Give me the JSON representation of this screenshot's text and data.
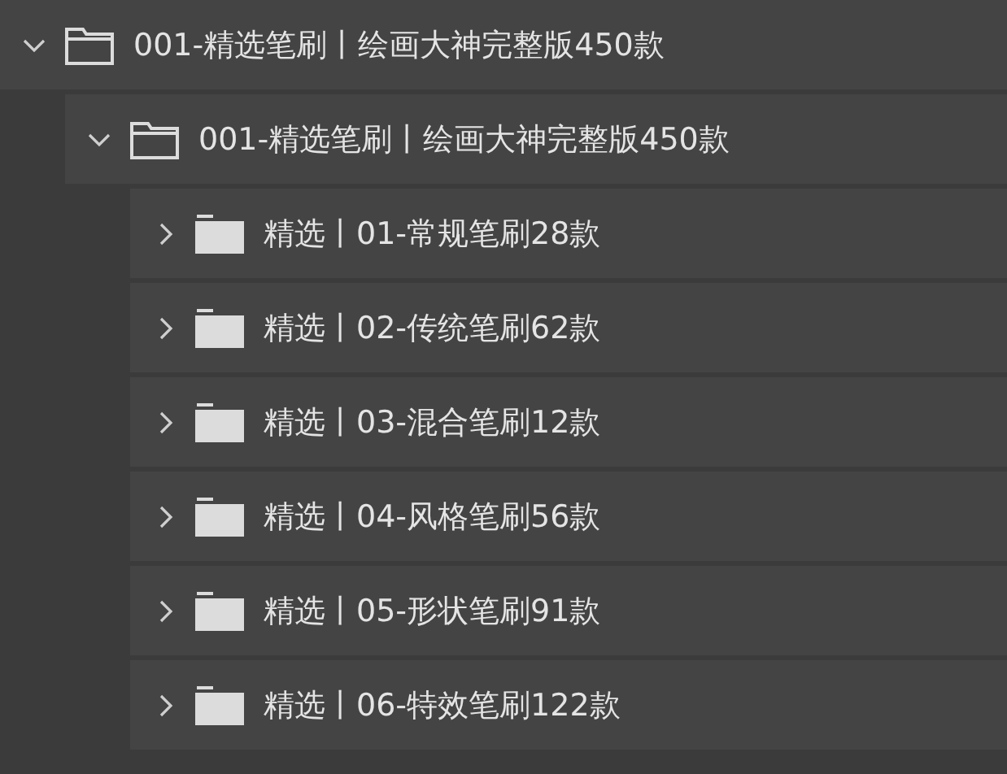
{
  "tree": [
    {
      "label": "001-精选笔刷丨绘画大神完整版450款",
      "expanded": true,
      "children": [
        {
          "label": "001-精选笔刷丨绘画大神完整版450款",
          "expanded": true,
          "children": [
            {
              "label": "精选丨01-常规笔刷28款",
              "expanded": false
            },
            {
              "label": "精选丨02-传统笔刷62款",
              "expanded": false
            },
            {
              "label": "精选丨03-混合笔刷12款",
              "expanded": false
            },
            {
              "label": "精选丨04-风格笔刷56款",
              "expanded": false
            },
            {
              "label": "精选丨05-形状笔刷91款",
              "expanded": false
            },
            {
              "label": "精选丨06-特效笔刷122款",
              "expanded": false
            }
          ]
        }
      ]
    }
  ]
}
